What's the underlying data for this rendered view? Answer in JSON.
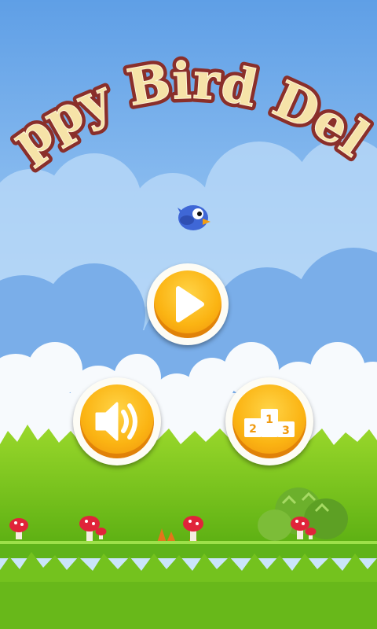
{
  "game": {
    "title": "Pluppy Bird Deluxe"
  },
  "buttons": {
    "play": {
      "icon": "play-icon"
    },
    "sound": {
      "icon": "speaker-icon"
    },
    "leaderboard": {
      "icon": "podium-icon",
      "ranks": [
        "2",
        "1",
        "3"
      ]
    }
  },
  "colors": {
    "sky_top": "#6aa8e8",
    "sky_bottom": "#c9e4fb",
    "hill": "#7fb2ea",
    "grass": "#7ccc1c",
    "grass_dark": "#4e9a10",
    "button_orange": "#f9b20f",
    "bird": "#3f67d6",
    "title_fill": "#f6e3a8",
    "title_outline": "#8a2f2a"
  }
}
